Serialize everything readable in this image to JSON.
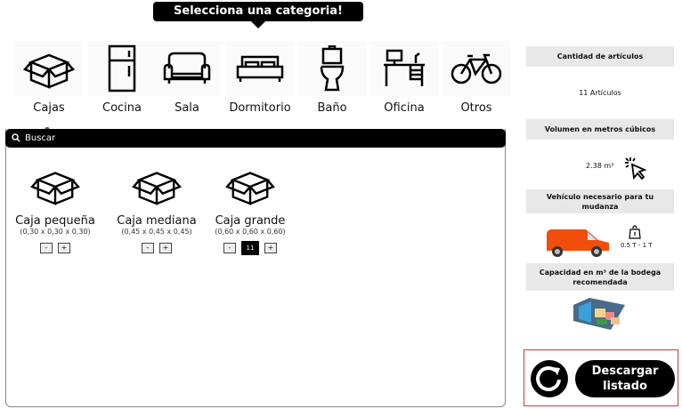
{
  "tooltip": "Selecciona una categoria!",
  "categories": [
    {
      "label": "Cajas"
    },
    {
      "label": "Cocina"
    },
    {
      "label": "Sala"
    },
    {
      "label": "Dormitorio"
    },
    {
      "label": "Baño"
    },
    {
      "label": "Oficina"
    },
    {
      "label": "Otros"
    }
  ],
  "search": {
    "placeholder": "Buscar"
  },
  "items": [
    {
      "name": "Caja pequeña",
      "dims": "(0,30 x 0,30 x 0,30)",
      "minus": "-",
      "plus": "+"
    },
    {
      "name": "Caja mediana",
      "dims": "(0,45 x 0,45 x 0,45)",
      "minus": "-",
      "plus": "+"
    },
    {
      "name": "Caja grande",
      "dims": "(0,60 x 0,60 x 0,60)",
      "minus": "-",
      "plus": "+",
      "qty": "11"
    }
  ],
  "summary": {
    "count_title": "Cantidad de artículos",
    "count_value": "11 Artículos",
    "volume_title": "Volumen en metros cúbicos",
    "volume_value": "2.38 m³",
    "vehicle_title": "Vehículo necesario para tu mudanza",
    "vehicle_capacity": "0.5 T - 1 T",
    "storage_title": "Capacidad en m³ de la bodega recomendada"
  },
  "actions": {
    "download": "Descargar listado"
  },
  "colors": {
    "van": "#f04e0a",
    "highlight": "#d33333"
  }
}
